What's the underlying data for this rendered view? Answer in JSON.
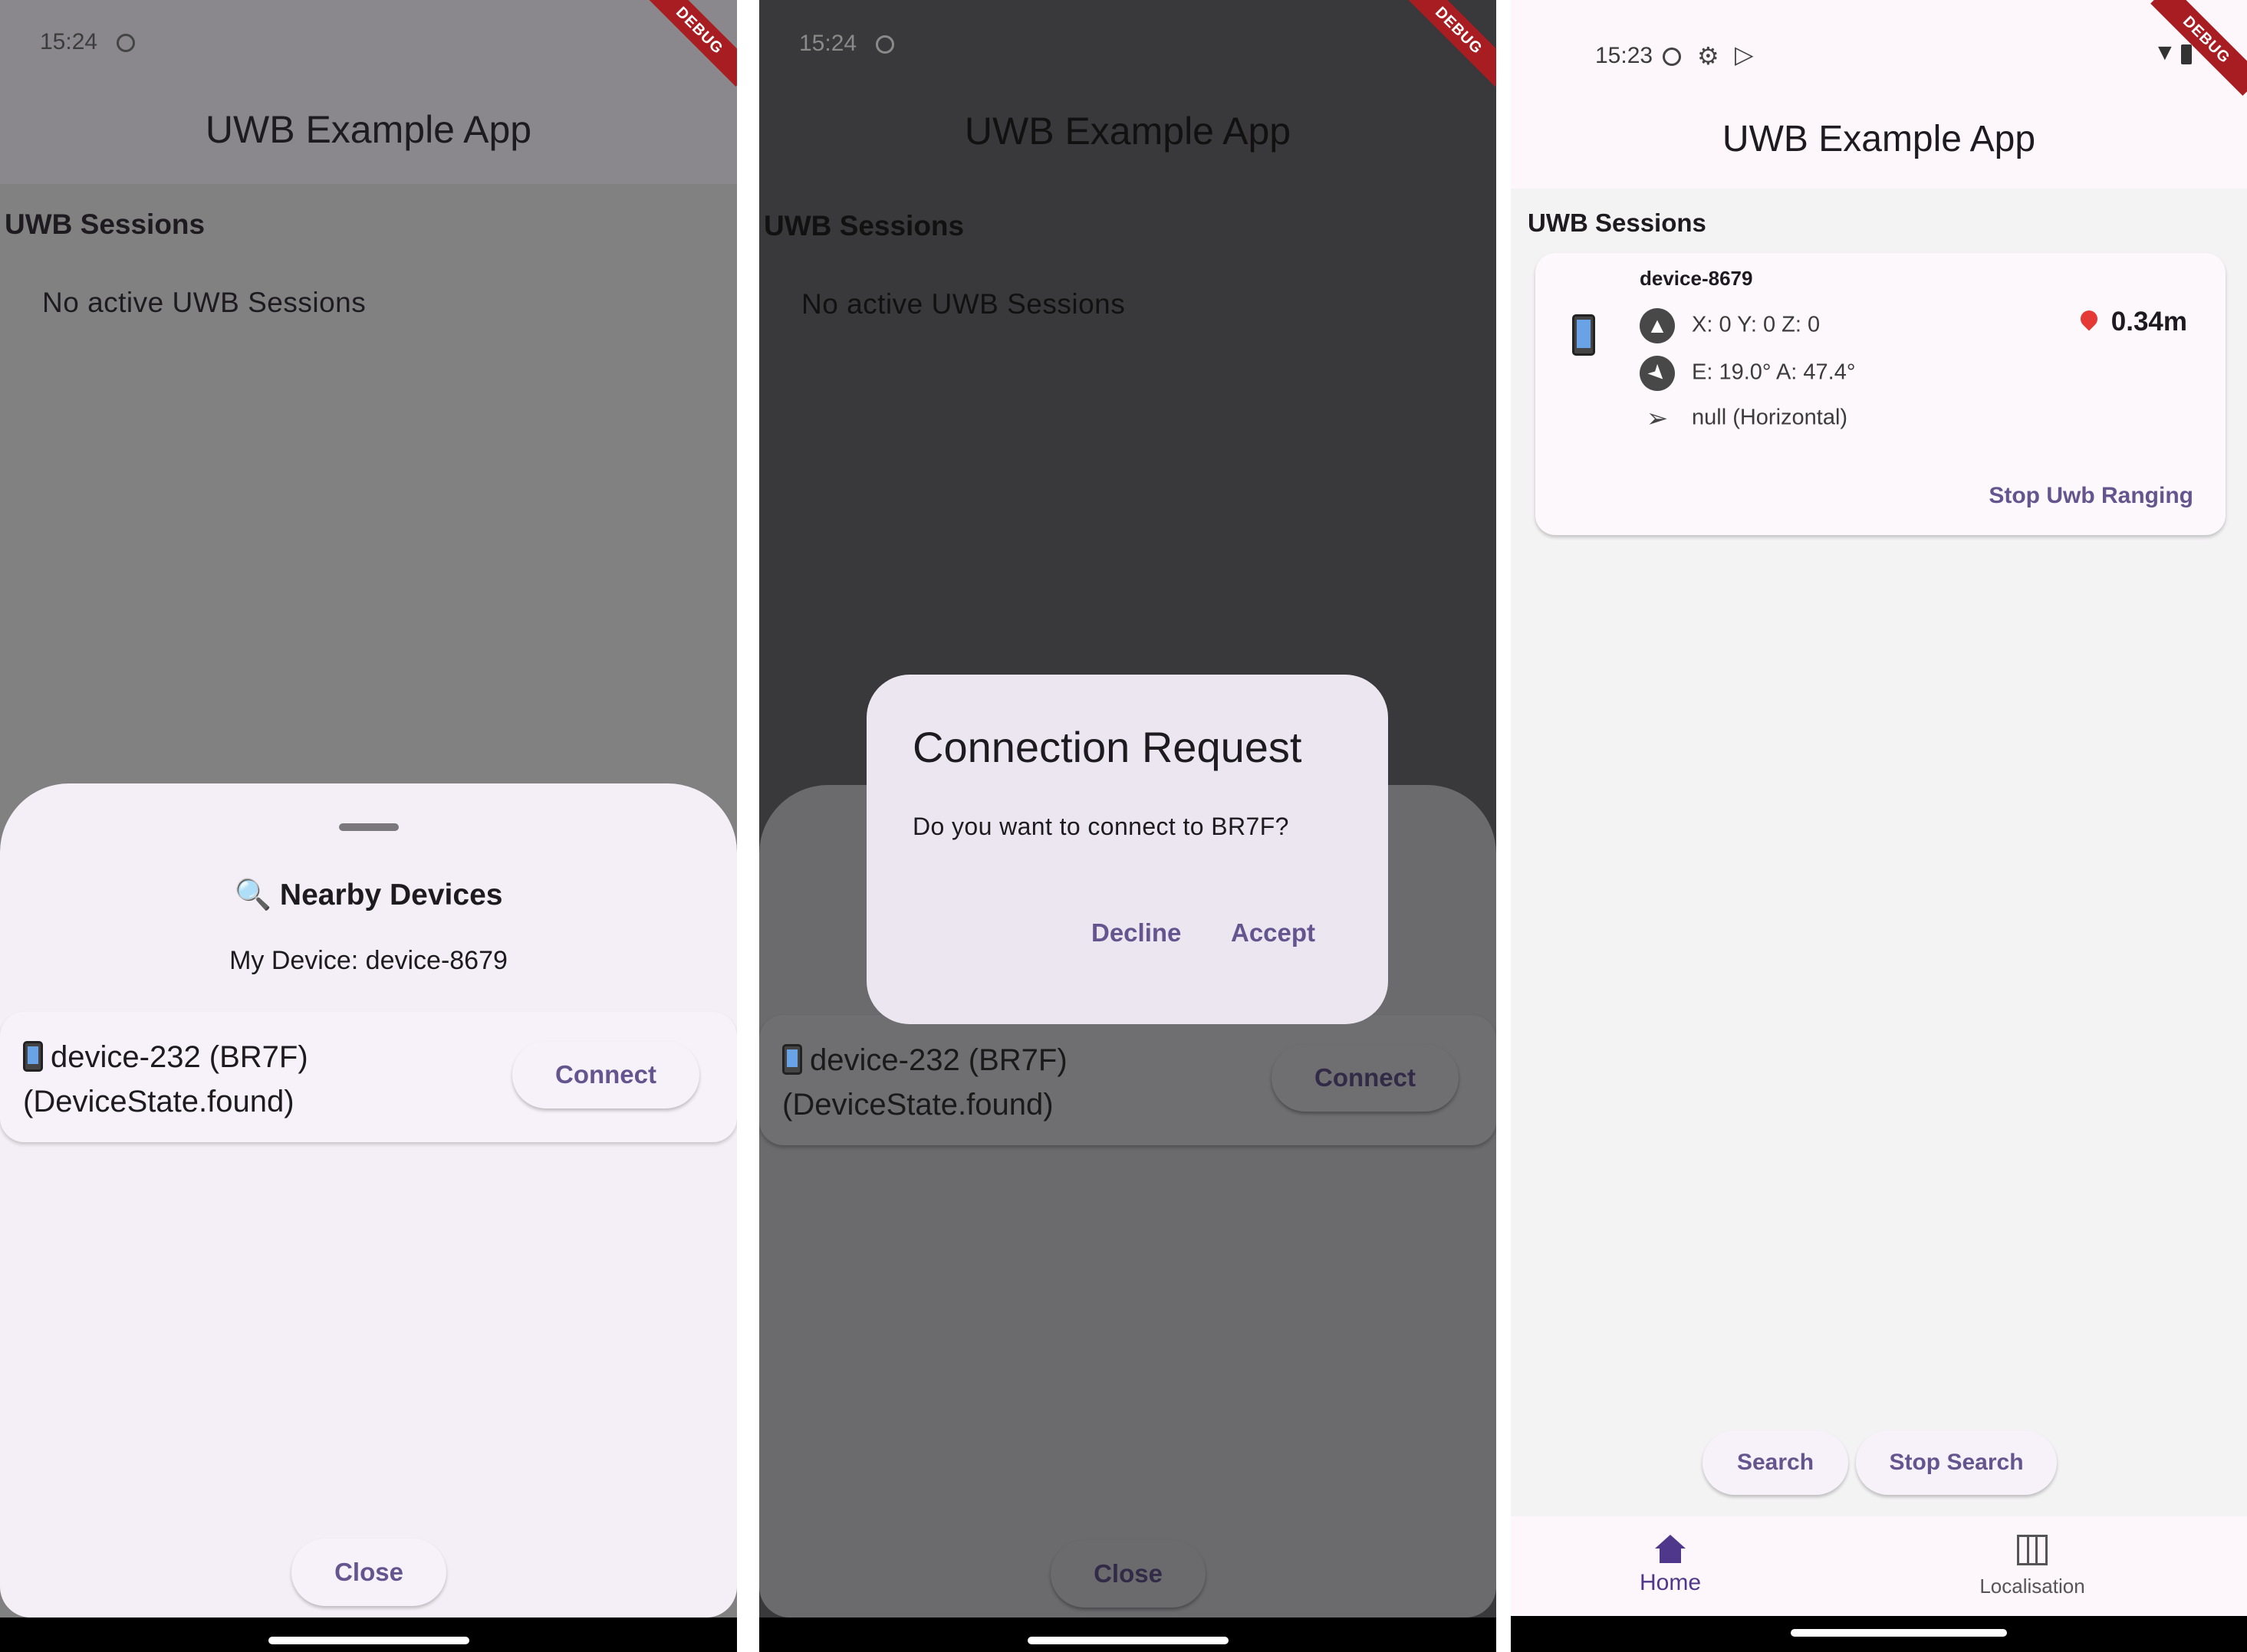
{
  "screen1": {
    "status_time": "15:24",
    "app_title": "UWB Example App",
    "debug_banner": "DEBUG",
    "sessions_title": "UWB Sessions",
    "no_sessions": "No active UWB Sessions",
    "sheet": {
      "title": "🔍 Nearby Devices",
      "my_device": "My Device: device-8679",
      "device_line1": "device-232 (BR7F)",
      "device_line2": "(DeviceState.found)",
      "connect_label": "Connect",
      "close_label": "Close"
    }
  },
  "screen2": {
    "status_time": "15:24",
    "app_title": "UWB Example App",
    "debug_banner": "DEBUG",
    "sessions_title": "UWB Sessions",
    "no_sessions": "No active UWB Sessions",
    "device_line1": "device-232 (BR7F)",
    "device_line2": "(DeviceState.found)",
    "connect_label": "Connect",
    "close_label": "Close",
    "dialog": {
      "title": "Connection Request",
      "body": "Do you want to connect to BR7F?",
      "decline_label": "Decline",
      "accept_label": "Accept"
    }
  },
  "screen3": {
    "status_time": "15:23",
    "app_title": "UWB Example App",
    "debug_banner": "DEBUG",
    "sessions_title": "UWB Sessions",
    "session": {
      "device_name": "device-8679",
      "position": "X: 0 Y: 0 Z: 0",
      "angles": "E: 19.0° A: 47.4°",
      "orientation": "null  (Horizontal)",
      "distance": "0.34m",
      "stop_ranging_label": "Stop Uwb Ranging"
    },
    "search_label": "Search",
    "stop_search_label": "Stop Search",
    "nav": {
      "home_label": "Home",
      "localisation_label": "Localisation"
    }
  },
  "colors": {
    "accent": "#65558f",
    "sheet_bg": "#f4eff6",
    "dialog_bg": "#ece6f0",
    "debug_red": "#a81d22"
  }
}
